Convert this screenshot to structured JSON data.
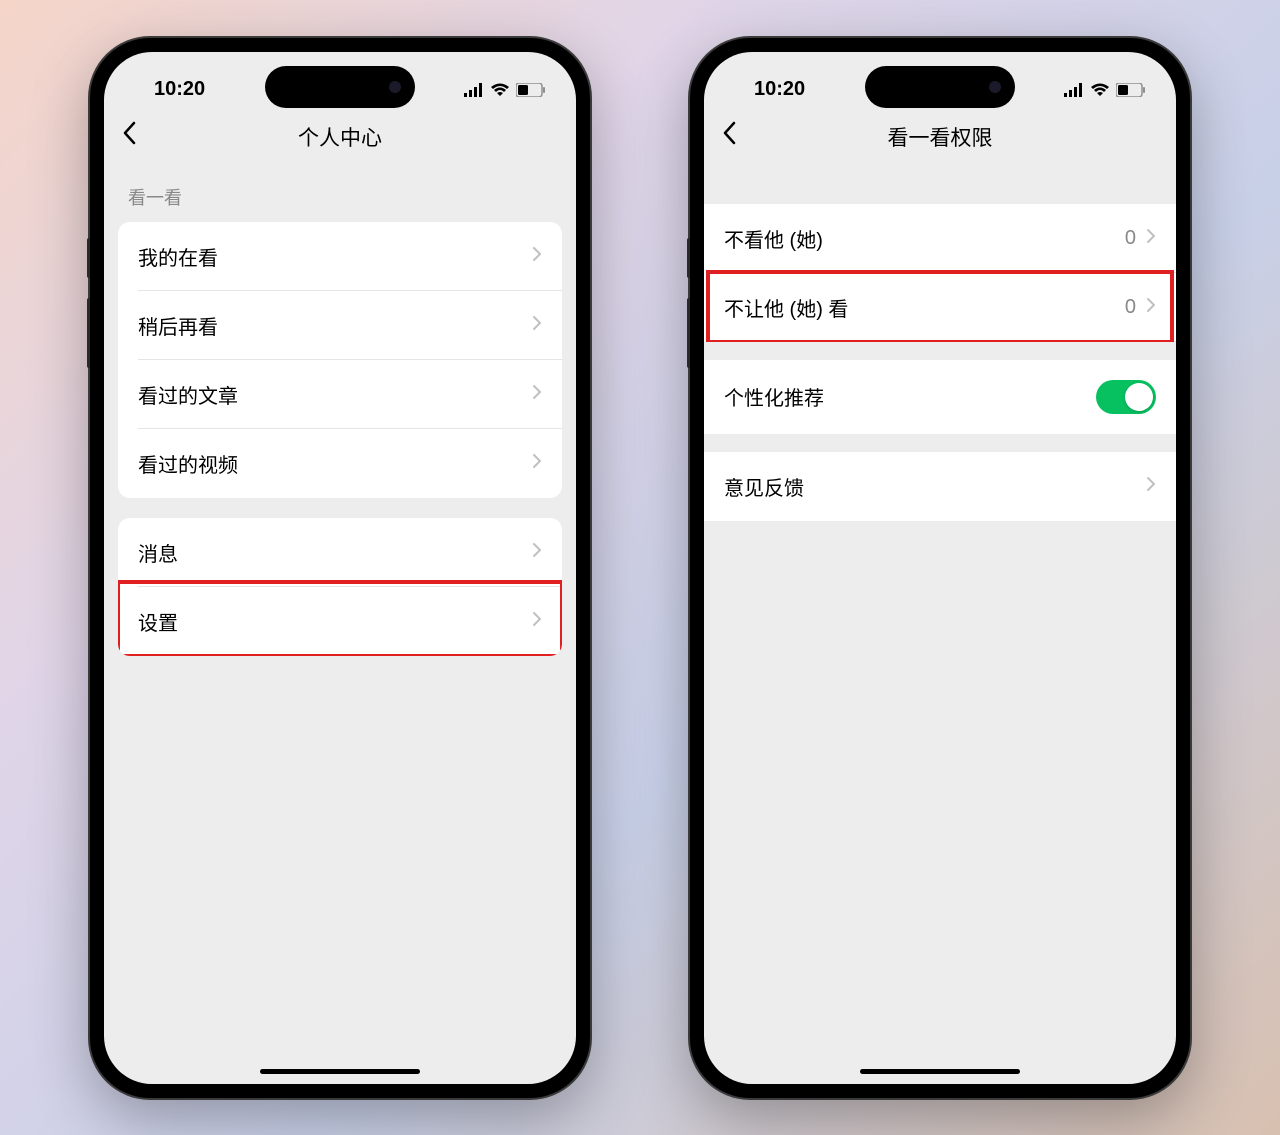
{
  "status": {
    "time": "10:20"
  },
  "phone1": {
    "nav_title": "个人中心",
    "section1_header": "看一看",
    "group1": [
      {
        "label": "我的在看"
      },
      {
        "label": "稍后再看"
      },
      {
        "label": "看过的文章"
      },
      {
        "label": "看过的视频"
      }
    ],
    "group2": [
      {
        "label": "消息"
      },
      {
        "label": "设置"
      }
    ]
  },
  "phone2": {
    "nav_title": "看一看权限",
    "group1": [
      {
        "label": "不看他 (她)",
        "value": "0"
      },
      {
        "label": "不让他 (她) 看",
        "value": "0"
      }
    ],
    "group2": [
      {
        "label": "个性化推荐",
        "toggle": true
      }
    ],
    "group3": [
      {
        "label": "意见反馈"
      }
    ]
  }
}
